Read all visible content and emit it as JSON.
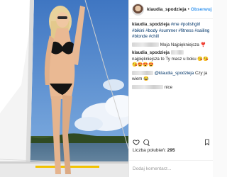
{
  "header": {
    "username": "klaudia_spodzieja",
    "separator": "•",
    "follow_label": "Obserwuj"
  },
  "caption": {
    "username": "klaudia_spodzieja",
    "hashtags": "#me #polishgirl #bikini #body #summer #fitness #sailing #blonde #chill"
  },
  "comments": [
    {
      "text": "Moja Najpiękniejsza",
      "emoji": "❣️"
    },
    {
      "username": "klaudia_spodzieja",
      "text": "najpiękniejsza to Ty masz u boku",
      "emoji": "😘😘😘😍😍😍"
    },
    {
      "mention": "@klaudia_spodzieja",
      "text": "Czy ja wiem 😂"
    },
    {
      "text": "nice"
    }
  ],
  "likes": {
    "label": "Liczba polubień:",
    "count": "295"
  },
  "add_comment_placeholder": "Dodaj komentarz...",
  "icons": [
    "heart-icon",
    "comment-icon",
    "bookmark-icon"
  ]
}
